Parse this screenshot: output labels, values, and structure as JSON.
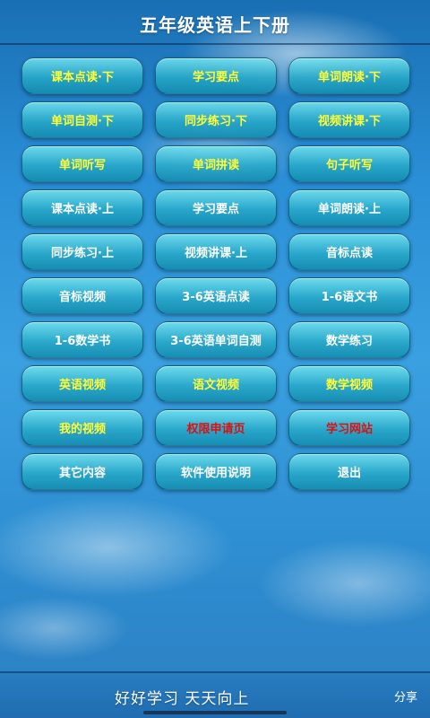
{
  "header": {
    "title": "五年级英语上下册"
  },
  "buttons": [
    {
      "label": "课本点读·下",
      "color": "#ffff33"
    },
    {
      "label": "学习要点",
      "color": "#ffff33"
    },
    {
      "label": "单词朗读·下",
      "color": "#ffff33"
    },
    {
      "label": "单词自测·下",
      "color": "#ffff33"
    },
    {
      "label": "同步练习·下",
      "color": "#ffff33"
    },
    {
      "label": "视频讲课·下",
      "color": "#ffff33"
    },
    {
      "label": "单词听写",
      "color": "#ffff33"
    },
    {
      "label": "单词拼读",
      "color": "#ffff33"
    },
    {
      "label": "句子听写",
      "color": "#ffff33"
    },
    {
      "label": "课本点读·上",
      "color": "#ffffff"
    },
    {
      "label": "学习要点",
      "color": "#ffffff"
    },
    {
      "label": "单词朗读·上",
      "color": "#ffffff"
    },
    {
      "label": "同步练习·上",
      "color": "#ffffff"
    },
    {
      "label": "视频讲课·上",
      "color": "#ffffff"
    },
    {
      "label": "音标点读",
      "color": "#ffffff"
    },
    {
      "label": "音标视频",
      "color": "#ffffff"
    },
    {
      "label": "3-6英语点读",
      "color": "#ffffff"
    },
    {
      "label": "1-6语文书",
      "color": "#ffffff"
    },
    {
      "label": "1-6数学书",
      "color": "#ffffff"
    },
    {
      "label": "3-6英语单词自测",
      "color": "#ffffff"
    },
    {
      "label": "数学练习",
      "color": "#ffffff"
    },
    {
      "label": "英语视频",
      "color": "#ffff33"
    },
    {
      "label": "语文视频",
      "color": "#ffff33"
    },
    {
      "label": "数学视频",
      "color": "#ffff33"
    },
    {
      "label": "我的视频",
      "color": "#ffff33"
    },
    {
      "label": "权限申请页",
      "color": "#dd1111"
    },
    {
      "label": "学习网站",
      "color": "#dd1111"
    },
    {
      "label": "其它内容",
      "color": "#ffffff"
    },
    {
      "label": "软件使用说明",
      "color": "#ffffff"
    },
    {
      "label": "退出",
      "color": "#ffffff"
    }
  ],
  "footer": {
    "slogan": "好好学习  天天向上",
    "share_label": "分享"
  }
}
